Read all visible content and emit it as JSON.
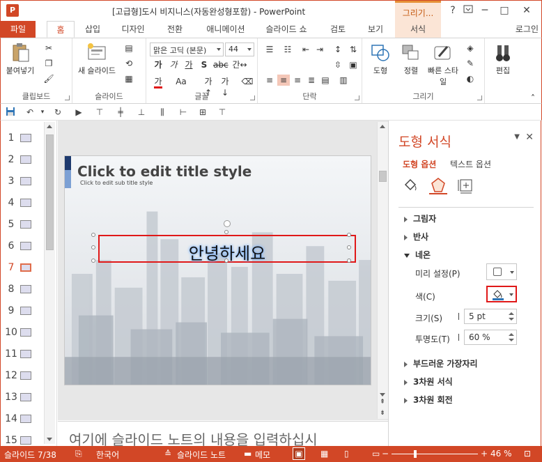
{
  "window": {
    "title": "[고급형]도시 비지니스(자동완성형포함) - PowerPoint",
    "context_tab_header": "그리기...",
    "help": "?",
    "minimize": "─",
    "maximize": "□",
    "close": "✕"
  },
  "tabs": {
    "file": "파일",
    "items": [
      "홈",
      "삽입",
      "디자인",
      "전환",
      "애니메이션",
      "슬라이드 쇼",
      "검토",
      "보기",
      "서식"
    ],
    "login": "로그인"
  },
  "ribbon": {
    "clipboard": {
      "paste": "붙여넣기",
      "label": "클립보드"
    },
    "slides": {
      "new_slide": "새 슬라이드",
      "label": "슬라이드"
    },
    "font": {
      "font_name": "맑은 고딕 (본문)",
      "font_size": "44",
      "label": "글꼴"
    },
    "paragraph": {
      "label": "단락"
    },
    "drawing": {
      "shape": "도형",
      "arrange": "정렬",
      "quick_style": "빠른 스타일",
      "label": "그리기"
    },
    "editing": {
      "edit": "편집"
    }
  },
  "thumbnails": {
    "numbers": [
      "1",
      "2",
      "3",
      "4",
      "5",
      "6",
      "7",
      "8",
      "9",
      "10",
      "11",
      "12",
      "13",
      "14",
      "15"
    ],
    "selected_index": 6
  },
  "slide": {
    "title": "Click to edit title style",
    "subtitle": "Click to edit sub title style",
    "shape_text": "안녕하세요"
  },
  "notes": {
    "text": "여기에 슬라이드 노트의 내용을 입력하십시"
  },
  "format_pane": {
    "title": "도형 서식",
    "tab_shape": "도형 옵션",
    "tab_text": "텍스트 옵션",
    "sections": {
      "shadow": "그림자",
      "reflection": "반사",
      "glow": "네온",
      "soft_edges": "부드러운 가장자리",
      "threed_format": "3차원 서식",
      "threed_rotation": "3차원 회전"
    },
    "glow": {
      "preset_label": "미리 설정(P)",
      "color_label": "색(C)",
      "size_label": "크기(S)",
      "size_value": "5 pt",
      "transparency_label": "투명도(T)",
      "transparency_value": "60 %"
    }
  },
  "status": {
    "slide_info": "슬라이드 7/38",
    "language": "한국어",
    "notes": "슬라이드 노트",
    "comments": "메모",
    "zoom": "46 %"
  },
  "colors": {
    "accent": "#d24726",
    "highlight": "#e01818",
    "glow": "#7ab4ff"
  }
}
